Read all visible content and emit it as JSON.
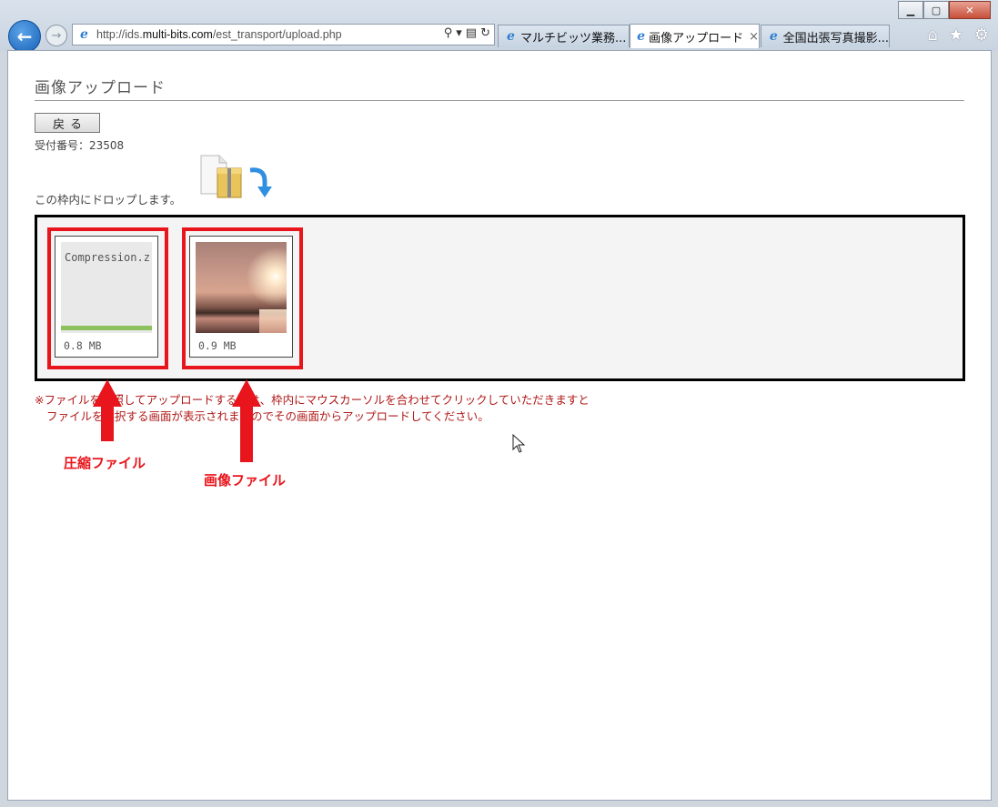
{
  "browser": {
    "url_prefix": "http://ids.",
    "url_domain": "multi-bits.com",
    "url_path": "/est_transport/upload.php",
    "tabs": [
      {
        "label": "マルチビッツ業務...",
        "active": false
      },
      {
        "label": "画像アップロード",
        "active": true
      },
      {
        "label": "全国出張写真撮影...",
        "active": false
      }
    ],
    "tab_close": "×"
  },
  "page": {
    "title": "画像アップロード",
    "back_button": "戻る",
    "receipt": "受付番号：23508",
    "drop_hint": "この枠内にドロップします。",
    "files": [
      {
        "name": "Compression.z",
        "size": "0.8 MB",
        "type": "zip",
        "progress": 1.0
      },
      {
        "name": "",
        "size": "0.9 MB",
        "type": "image"
      }
    ],
    "notice_line1": "※ファイルを参照してアップロードする際は、枠内にマウスカーソルを合わせてクリックしていただきますと",
    "notice_line2": "ファイルを選択する画面が表示されますのでその画面からアップロードしてください。"
  },
  "annotations": {
    "label_zip": "圧縮ファイル",
    "label_image": "画像ファイル",
    "color": "#e8151c"
  }
}
